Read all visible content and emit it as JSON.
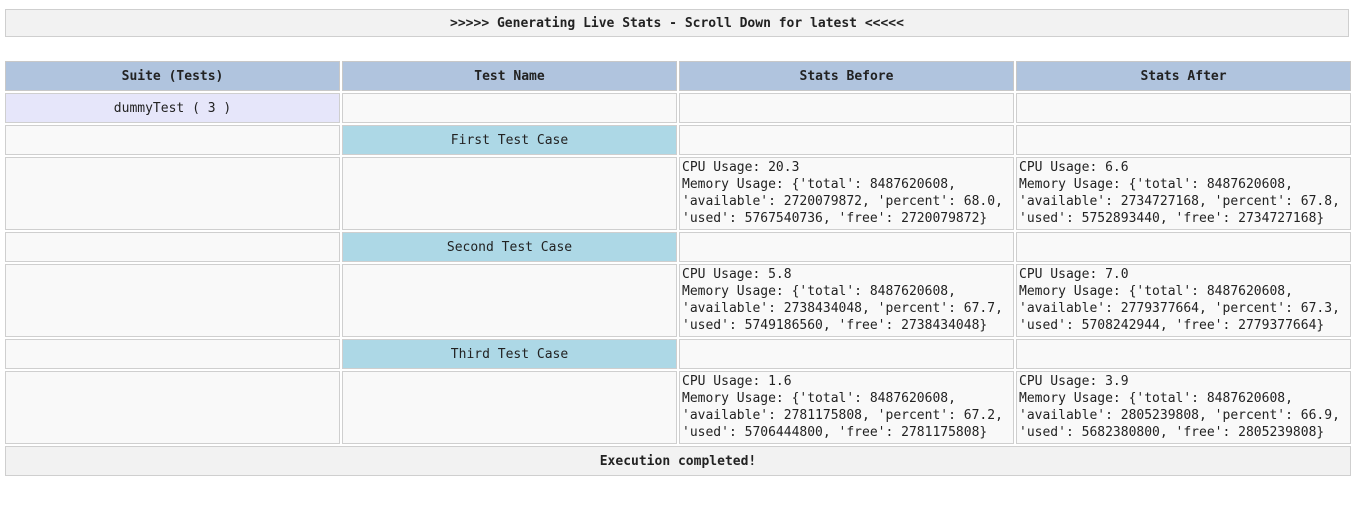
{
  "banner": {
    "text": ">>>>> Generating Live Stats - Scroll Down for latest <<<<<"
  },
  "table": {
    "headers": [
      "Suite (Tests)",
      "Test Name",
      "Stats Before",
      "Stats After"
    ],
    "suite_label": "dummyTest ( 3 )",
    "tests": [
      {
        "name": "First Test Case",
        "before": "CPU Usage: 20.3\nMemory Usage: {'total': 8487620608, 'available': 2720079872, 'percent': 68.0, 'used': 5767540736, 'free': 2720079872}",
        "after": "CPU Usage: 6.6\nMemory Usage: {'total': 8487620608, 'available': 2734727168, 'percent': 67.8, 'used': 5752893440, 'free': 2734727168}"
      },
      {
        "name": "Second Test Case",
        "before": "CPU Usage: 5.8\nMemory Usage: {'total': 8487620608, 'available': 2738434048, 'percent': 67.7, 'used': 5749186560, 'free': 2738434048}",
        "after": "CPU Usage: 7.0\nMemory Usage: {'total': 8487620608, 'available': 2779377664, 'percent': 67.3, 'used': 5708242944, 'free': 2779377664}"
      },
      {
        "name": "Third Test Case",
        "before": "CPU Usage: 1.6\nMemory Usage: {'total': 8487620608, 'available': 2781175808, 'percent': 67.2, 'used': 5706444800, 'free': 2781175808}",
        "after": "CPU Usage: 3.9\nMemory Usage: {'total': 8487620608, 'available': 2805239808, 'percent': 66.9, 'used': 5682380800, 'free': 2805239808}"
      }
    ],
    "footer": "Execution completed!"
  },
  "colors": {
    "header_bg": "#b0c4de",
    "suite_bg": "#e6e6fa",
    "testname_bg": "#add8e6",
    "cell_bg": "#f9f9f9",
    "banner_bg": "#f2f2f2"
  }
}
